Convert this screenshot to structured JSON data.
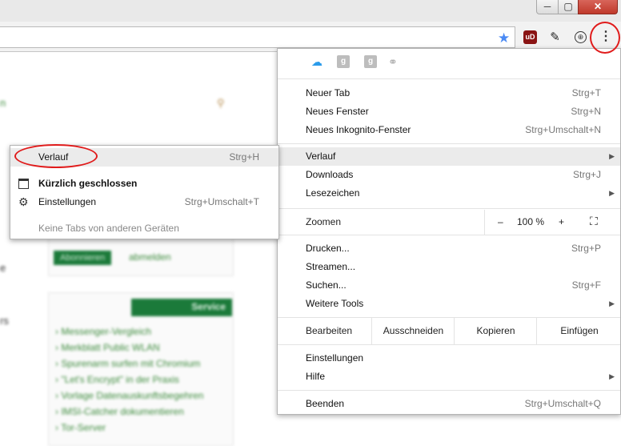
{
  "window": {
    "min_label": "─",
    "max_label": "▢",
    "close_label": "✕"
  },
  "toolbar": {
    "star_glyph": "★",
    "ext_ublock": "uD",
    "ext_pin": "✎",
    "ext_key": "⊕",
    "menu_glyph": "⋮"
  },
  "page": {
    "link_top": "n",
    "nav1": "e",
    "nav2": "rs",
    "subscribe": "Abonnieren",
    "unsubscribe": "abmelden",
    "service": "Service",
    "links": [
      "Messenger-Vergleich",
      "Merkblatt Public WLAN",
      "Spurenarm surfen mit Chromium",
      "\"Let's Encrypt\" in der Praxis",
      "Vorlage Datenauskunftsbegehren",
      "IMSI-Catcher dokumentieren",
      "Tor-Server"
    ]
  },
  "menu": {
    "bookmark_icons": [
      "cloud-icon",
      "google-plus-icon",
      "google-plus-icon",
      "link-icon"
    ],
    "items": {
      "new_tab": {
        "label": "Neuer Tab",
        "shortcut": "Strg+T"
      },
      "new_window": {
        "label": "Neues Fenster",
        "shortcut": "Strg+N"
      },
      "incognito": {
        "label": "Neues Inkognito-Fenster",
        "shortcut": "Strg+Umschalt+N"
      },
      "history": {
        "label": "Verlauf",
        "arrow": "▶"
      },
      "downloads": {
        "label": "Downloads",
        "shortcut": "Strg+J"
      },
      "bookmarks": {
        "label": "Lesezeichen",
        "arrow": "▶"
      },
      "print": {
        "label": "Drucken...",
        "shortcut": "Strg+P"
      },
      "cast": {
        "label": "Streamen..."
      },
      "find": {
        "label": "Suchen...",
        "shortcut": "Strg+F"
      },
      "more_tools": {
        "label": "Weitere Tools",
        "arrow": "▶"
      },
      "settings": {
        "label": "Einstellungen"
      },
      "help": {
        "label": "Hilfe",
        "arrow": "▶"
      },
      "exit": {
        "label": "Beenden",
        "shortcut": "Strg+Umschalt+Q"
      }
    },
    "zoom": {
      "label": "Zoomen",
      "minus": "–",
      "value": "100 %",
      "plus": "+",
      "fullscreen": "⛶"
    },
    "edit": {
      "label": "Bearbeiten",
      "cut": "Ausschneiden",
      "copy": "Kopieren",
      "paste": "Einfügen"
    }
  },
  "submenu": {
    "history": {
      "label": "Verlauf",
      "shortcut": "Strg+H"
    },
    "recently_closed": {
      "label": "Kürzlich geschlossen"
    },
    "settings": {
      "label": "Einstellungen",
      "shortcut": "Strg+Umschalt+T"
    },
    "no_tabs": {
      "label": "Keine Tabs von anderen Geräten"
    }
  }
}
